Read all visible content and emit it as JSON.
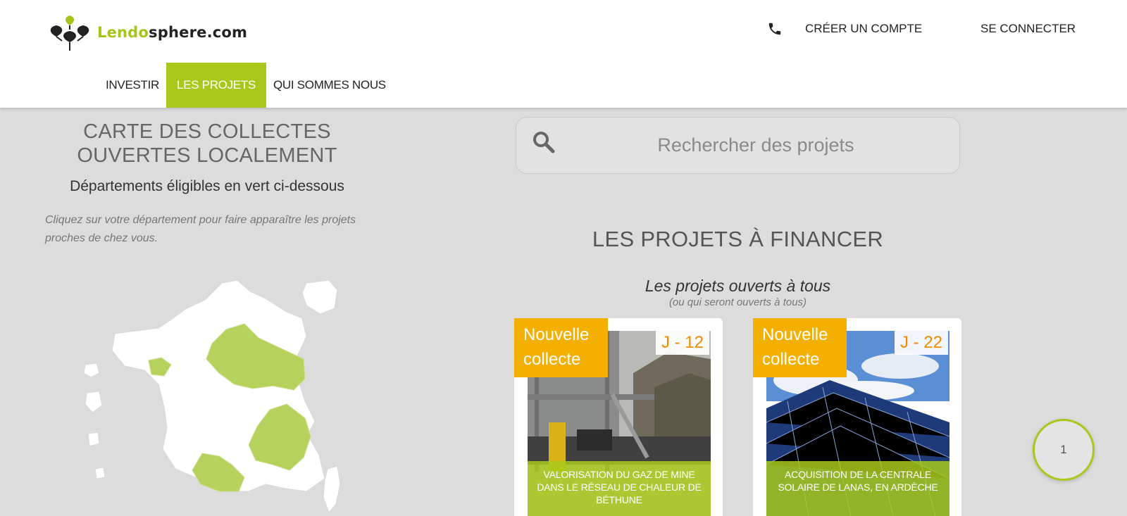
{
  "brand": {
    "logo_prefix": "Lendo",
    "logo_suffix": "sphere.com",
    "accent": "#a8c91b",
    "badge_color": "#f4b000",
    "countdown_color": "#f08a00"
  },
  "header": {
    "phone_icon": "phone-icon",
    "create_account": "CRÉER UN COMPTE",
    "login": "SE CONNECTER"
  },
  "nav": [
    {
      "label": "INVESTIR",
      "active": false
    },
    {
      "label": "LES PROJETS",
      "active": true
    },
    {
      "label": "QUI SOMMES NOUS",
      "active": false
    }
  ],
  "map": {
    "title_line1": "CARTE DES COLLECTES",
    "title_line2": "OUVERTES LOCALEMENT",
    "subtitle": "Départements éligibles en vert ci-dessous",
    "hint": "Cliquez sur votre département pour faire apparaître les projets proches de chez vous."
  },
  "search": {
    "placeholder": "Rechercher des projets",
    "icon": "search-icon"
  },
  "projects": {
    "title": "LES PROJETS À FINANCER",
    "open_all": "Les projets ouverts à tous",
    "open_all_sub": "(ou qui seront ouverts à tous)",
    "cards": [
      {
        "badge_line1": "Nouvelle",
        "badge_line2": "collecte",
        "countdown": "J - 12",
        "caption": "VALORISATION DU GAZ DE MINE DANS LE RÉSEAU DE CHALEUR DE BÉTHUNE"
      },
      {
        "badge_line1": "Nouvelle",
        "badge_line2": "collecte",
        "countdown": "J - 22",
        "caption": "ACQUISITION DE LA CENTRALE SOLAIRE DE LANAS, EN ARDÈCHE"
      }
    ]
  },
  "floating_counter": "1"
}
